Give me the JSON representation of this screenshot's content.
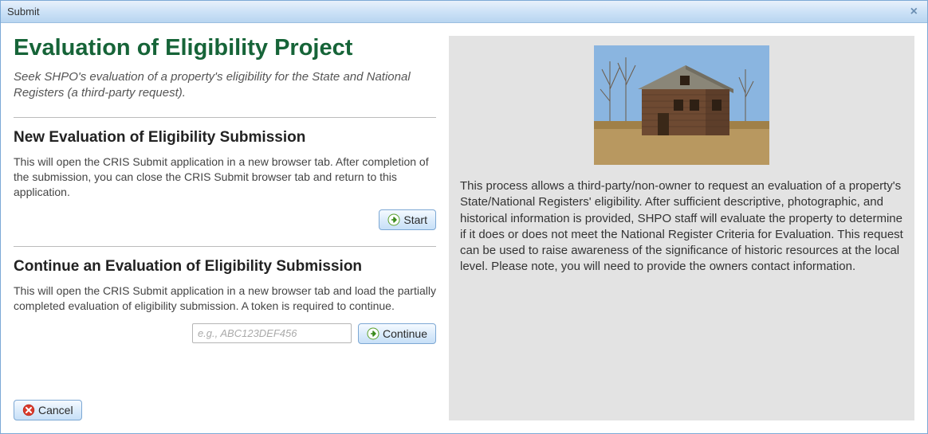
{
  "window": {
    "title": "Submit"
  },
  "page": {
    "title": "Evaluation of Eligibility Project",
    "subtitle": "Seek SHPO's evaluation of a property's eligibility for the State and National Registers (a third-party request)."
  },
  "sections": {
    "new": {
      "heading": "New Evaluation of Eligibility Submission",
      "text": "This will open the CRIS Submit application in a new browser tab. After completion of the submission, you can close the CRIS Submit browser tab and return to this application.",
      "button": "Start"
    },
    "continue": {
      "heading": "Continue an Evaluation of Eligibility Submission",
      "text": "This will open the CRIS Submit application in a new browser tab and load the partially completed evaluation of eligibility submission. A token is required to continue.",
      "placeholder": "e.g., ABC123DEF456",
      "button": "Continue"
    }
  },
  "footer": {
    "cancel": "Cancel"
  },
  "right": {
    "text": "This process allows a third-party/non-owner to request an evaluation of a property's State/National Registers' eligibility. After sufficient descriptive, photographic, and historical information is provided, SHPO staff will evaluate the property to determine if it does or does not meet the National Register Criteria for Evaluation. This request can be used to raise awareness of the significance of historic resources at the local level. Please note, you will need to provide the owners contact information."
  }
}
